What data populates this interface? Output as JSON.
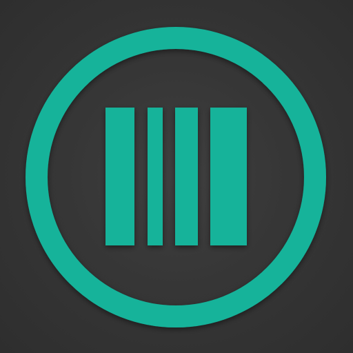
{
  "icon": {
    "name": "barcode-app-icon",
    "glyph": "barcode-icon",
    "colors": {
      "accent": "#14b39a",
      "background": "#343434",
      "background_highlight": "#3f3f3f",
      "background_edge": "#2e2e2e"
    }
  }
}
